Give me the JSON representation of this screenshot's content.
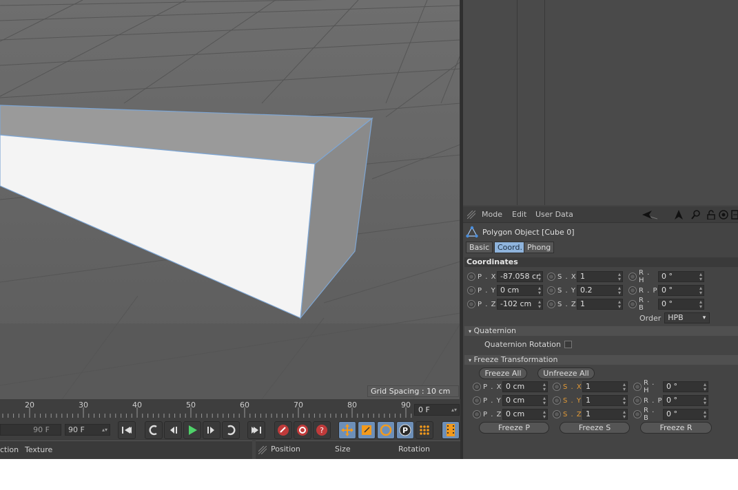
{
  "viewport": {
    "grid_spacing": "Grid Spacing : 10 cm"
  },
  "timeline": {
    "ticks": [
      "20",
      "30",
      "40",
      "50",
      "60",
      "70",
      "80",
      "90"
    ],
    "current_frame": "0 F"
  },
  "transport": {
    "end_frame_field": "90 F",
    "max_frame_field": "90 F"
  },
  "bottom_left": {
    "tabs": [
      "ction",
      "Texture"
    ]
  },
  "bottom_right": {
    "headers": [
      "Position",
      "Size",
      "Rotation"
    ]
  },
  "attributes": {
    "menu": {
      "mode": "Mode",
      "edit": "Edit",
      "user_data": "User Data"
    },
    "object_title": "Polygon Object [Cube 0]",
    "tabs": {
      "basic": "Basic",
      "coord": "Coord.",
      "phong": "Phong"
    },
    "coordinates": {
      "header": "Coordinates",
      "px": {
        "label": "P . X",
        "value": "-87.058 cr"
      },
      "py": {
        "label": "P . Y",
        "value": "0 cm"
      },
      "pz": {
        "label": "P . Z",
        "value": "-102 cm"
      },
      "sx": {
        "label": "S . X",
        "value": "1"
      },
      "sy": {
        "label": "S . Y",
        "value": "0.2"
      },
      "sz": {
        "label": "S . Z",
        "value": "1"
      },
      "rh": {
        "label": "R . H",
        "value": "0 °"
      },
      "rp": {
        "label": "R . P",
        "value": "0 °"
      },
      "rb": {
        "label": "R . B",
        "value": "0 °"
      },
      "order_label": "Order",
      "order_value": "HPB"
    },
    "quaternion": {
      "header": "Quaternion",
      "rotation_label": "Quaternion Rotation"
    },
    "freeze": {
      "header": "Freeze Transformation",
      "freeze_all": "Freeze All",
      "unfreeze_all": "Unfreeze All",
      "px": {
        "label": "P . X",
        "value": "0 cm"
      },
      "py": {
        "label": "P . Y",
        "value": "0 cm"
      },
      "pz": {
        "label": "P . Z",
        "value": "0 cm"
      },
      "sx": {
        "label": "S . X",
        "value": "1"
      },
      "sy": {
        "label": "S . Y",
        "value": "1"
      },
      "sz": {
        "label": "S . Z",
        "value": "1"
      },
      "rh": {
        "label": "R . H",
        "value": "0 °"
      },
      "rp": {
        "label": "R . P",
        "value": "0 °"
      },
      "rb": {
        "label": "R . B",
        "value": "0 °"
      },
      "freeze_p": "Freeze P",
      "freeze_s": "Freeze S",
      "freeze_r": "Freeze R"
    }
  },
  "colors": {
    "selection_edge": "#7ea6d4",
    "active_tab": "#8fb4dc",
    "scale_label": "#e39a36"
  }
}
